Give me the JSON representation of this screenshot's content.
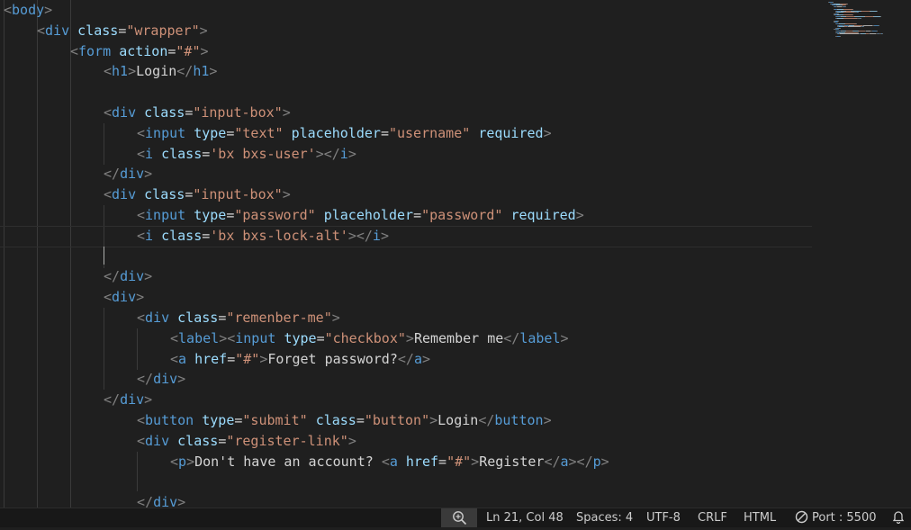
{
  "editor": {
    "language": "HTML",
    "lines": [
      [
        [
          "br",
          "<"
        ],
        [
          "t",
          "body"
        ],
        [
          "br",
          ">"
        ]
      ],
      [
        [
          "br",
          "<"
        ],
        [
          "t",
          "div"
        ],
        [
          "txt",
          " "
        ],
        [
          "a",
          "class"
        ],
        [
          "txt",
          "="
        ],
        [
          "s",
          "\"wrapper\""
        ],
        [
          "br",
          ">"
        ]
      ],
      [
        [
          "br",
          "<"
        ],
        [
          "t",
          "form"
        ],
        [
          "txt",
          " "
        ],
        [
          "a",
          "action"
        ],
        [
          "txt",
          "="
        ],
        [
          "s",
          "\"#\""
        ],
        [
          "br",
          ">"
        ]
      ],
      [
        [
          "br",
          "<"
        ],
        [
          "t",
          "h1"
        ],
        [
          "br",
          ">"
        ],
        [
          "txt",
          "Login"
        ],
        [
          "br",
          "</"
        ],
        [
          "t",
          "h1"
        ],
        [
          "br",
          ">"
        ]
      ],
      [],
      [
        [
          "br",
          "<"
        ],
        [
          "t",
          "div"
        ],
        [
          "txt",
          " "
        ],
        [
          "a",
          "class"
        ],
        [
          "txt",
          "="
        ],
        [
          "s",
          "\"input-box\""
        ],
        [
          "br",
          ">"
        ]
      ],
      [
        [
          "br",
          "<"
        ],
        [
          "t",
          "input"
        ],
        [
          "txt",
          " "
        ],
        [
          "a",
          "type"
        ],
        [
          "txt",
          "="
        ],
        [
          "s",
          "\"text\""
        ],
        [
          "txt",
          " "
        ],
        [
          "a",
          "placeholder"
        ],
        [
          "txt",
          "="
        ],
        [
          "s",
          "\"username\""
        ],
        [
          "txt",
          " "
        ],
        [
          "a",
          "required"
        ],
        [
          "br",
          ">"
        ]
      ],
      [
        [
          "br",
          "<"
        ],
        [
          "t",
          "i"
        ],
        [
          "txt",
          " "
        ],
        [
          "a",
          "class"
        ],
        [
          "txt",
          "="
        ],
        [
          "s",
          "'bx bxs-user'"
        ],
        [
          "br",
          "></"
        ],
        [
          "t",
          "i"
        ],
        [
          "br",
          ">"
        ]
      ],
      [
        [
          "br",
          "</"
        ],
        [
          "t",
          "div"
        ],
        [
          "br",
          ">"
        ]
      ],
      [
        [
          "br",
          "<"
        ],
        [
          "t",
          "div"
        ],
        [
          "txt",
          " "
        ],
        [
          "a",
          "class"
        ],
        [
          "txt",
          "="
        ],
        [
          "s",
          "\"input-box\""
        ],
        [
          "br",
          ">"
        ]
      ],
      [
        [
          "br",
          "<"
        ],
        [
          "t",
          "input"
        ],
        [
          "txt",
          " "
        ],
        [
          "a",
          "type"
        ],
        [
          "txt",
          "="
        ],
        [
          "s",
          "\"password\""
        ],
        [
          "txt",
          " "
        ],
        [
          "a",
          "placeholder"
        ],
        [
          "txt",
          "="
        ],
        [
          "s",
          "\"password\""
        ],
        [
          "txt",
          " "
        ],
        [
          "a",
          "required"
        ],
        [
          "br",
          ">"
        ]
      ],
      [
        [
          "br",
          "<"
        ],
        [
          "t",
          "i"
        ],
        [
          "txt",
          " "
        ],
        [
          "a",
          "class"
        ],
        [
          "txt",
          "="
        ],
        [
          "s",
          "'bx bxs-lock-alt'"
        ],
        [
          "br",
          "></"
        ],
        [
          "t",
          "i"
        ],
        [
          "br",
          ">"
        ]
      ],
      [],
      [
        [
          "br",
          "</"
        ],
        [
          "t",
          "div"
        ],
        [
          "br",
          ">"
        ]
      ],
      [
        [
          "br",
          "<"
        ],
        [
          "t",
          "div"
        ],
        [
          "br",
          ">"
        ]
      ],
      [
        [
          "br",
          "<"
        ],
        [
          "t",
          "div"
        ],
        [
          "txt",
          " "
        ],
        [
          "a",
          "class"
        ],
        [
          "txt",
          "="
        ],
        [
          "s",
          "\"remenber-me\""
        ],
        [
          "br",
          ">"
        ]
      ],
      [
        [
          "br",
          "<"
        ],
        [
          "t",
          "label"
        ],
        [
          "br",
          "><"
        ],
        [
          "t",
          "input"
        ],
        [
          "txt",
          " "
        ],
        [
          "a",
          "type"
        ],
        [
          "txt",
          "="
        ],
        [
          "s",
          "\"checkbox\""
        ],
        [
          "br",
          ">"
        ],
        [
          "txt",
          "Remember me"
        ],
        [
          "br",
          "</"
        ],
        [
          "t",
          "label"
        ],
        [
          "br",
          ">"
        ]
      ],
      [
        [
          "br",
          "<"
        ],
        [
          "t",
          "a"
        ],
        [
          "txt",
          " "
        ],
        [
          "a",
          "href"
        ],
        [
          "txt",
          "="
        ],
        [
          "s",
          "\"#\""
        ],
        [
          "br",
          ">"
        ],
        [
          "txt",
          "Forget password?"
        ],
        [
          "br",
          "</"
        ],
        [
          "t",
          "a"
        ],
        [
          "br",
          ">"
        ]
      ],
      [
        [
          "br",
          "</"
        ],
        [
          "t",
          "div"
        ],
        [
          "br",
          ">"
        ]
      ],
      [
        [
          "br",
          "</"
        ],
        [
          "t",
          "div"
        ],
        [
          "br",
          ">"
        ]
      ],
      [
        [
          "br",
          "<"
        ],
        [
          "t",
          "button"
        ],
        [
          "txt",
          " "
        ],
        [
          "a",
          "type"
        ],
        [
          "txt",
          "="
        ],
        [
          "s",
          "\"submit\""
        ],
        [
          "txt",
          " "
        ],
        [
          "a",
          "class"
        ],
        [
          "txt",
          "="
        ],
        [
          "s",
          "\"button\""
        ],
        [
          "br",
          ">"
        ],
        [
          "txt",
          "Login"
        ],
        [
          "br",
          "</"
        ],
        [
          "t",
          "button"
        ],
        [
          "br",
          ">"
        ]
      ],
      [
        [
          "br",
          "<"
        ],
        [
          "t",
          "div"
        ],
        [
          "txt",
          " "
        ],
        [
          "a",
          "class"
        ],
        [
          "txt",
          "="
        ],
        [
          "s",
          "\"register-link\""
        ],
        [
          "br",
          ">"
        ]
      ],
      [
        [
          "br",
          "<"
        ],
        [
          "t",
          "p"
        ],
        [
          "br",
          ">"
        ],
        [
          "txt",
          "Don't have an account? "
        ],
        [
          "br",
          "<"
        ],
        [
          "t",
          "a"
        ],
        [
          "txt",
          " "
        ],
        [
          "a",
          "href"
        ],
        [
          "txt",
          "="
        ],
        [
          "s",
          "\"#\""
        ],
        [
          "br",
          ">"
        ],
        [
          "txt",
          "Register"
        ],
        [
          "br",
          "</"
        ],
        [
          "t",
          "a"
        ],
        [
          "br",
          "></"
        ],
        [
          "t",
          "p"
        ],
        [
          "br",
          ">"
        ]
      ],
      [],
      [
        [
          "br",
          "</"
        ],
        [
          "t",
          "div"
        ],
        [
          "br",
          ">"
        ]
      ]
    ]
  },
  "colors": {
    "tag": "#569cd6",
    "bracket": "#808080",
    "attribute": "#9cdcfe",
    "string": "#ce9178",
    "text": "#d4d4d4"
  },
  "statusbar": {
    "zoom_icon": "zoom-in-icon",
    "cursor_position": "Ln 21, Col 48",
    "indentation": "Spaces: 4",
    "encoding": "UTF-8",
    "line_ending": "CRLF",
    "language_mode": "HTML",
    "live_server": "Port : 5500",
    "live_server_icon": "no-entry-icon",
    "notifications_icon": "bell-icon"
  }
}
